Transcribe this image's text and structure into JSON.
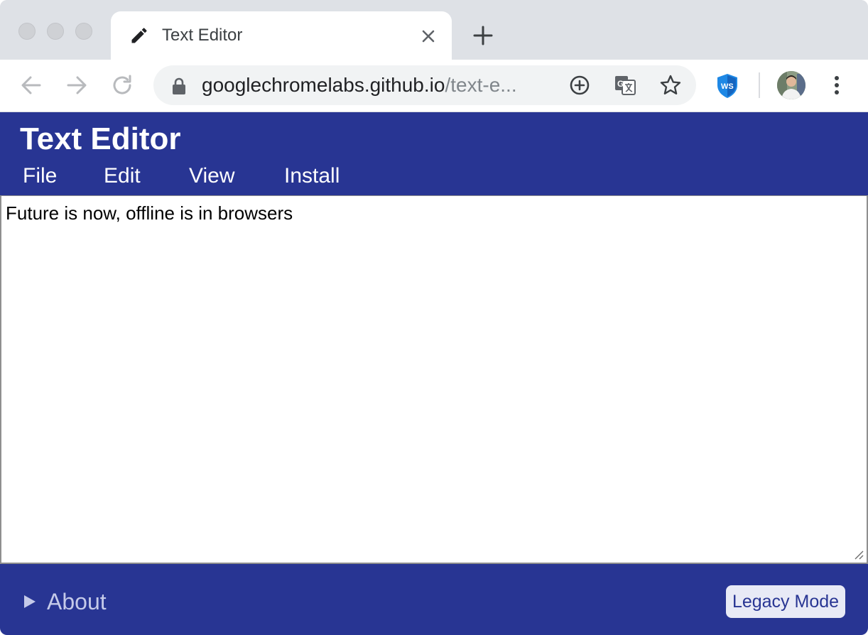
{
  "browser": {
    "tab": {
      "title": "Text Editor",
      "icon": "pencil-icon"
    },
    "address_bar": {
      "url_host": "googlechromelabs.github.io",
      "url_path": "/text-e..."
    },
    "toolbar_icons": [
      "back-icon",
      "forward-icon",
      "reload-icon",
      "lock-icon",
      "install-icon",
      "translate-icon",
      "star-icon",
      "ws-extension-icon",
      "avatar",
      "menu-icon"
    ]
  },
  "app": {
    "title": "Text Editor",
    "menu": [
      {
        "label": "File"
      },
      {
        "label": "Edit"
      },
      {
        "label": "View"
      },
      {
        "label": "Install"
      }
    ],
    "editor": {
      "content": "Future is now, offline is in browsers"
    },
    "footer": {
      "about_label": "About",
      "legacy_button": "Legacy Mode"
    }
  },
  "colors": {
    "accent": "#283593",
    "footer_text": "#c5cae9",
    "legacy_button_bg": "#e8eaf6"
  }
}
